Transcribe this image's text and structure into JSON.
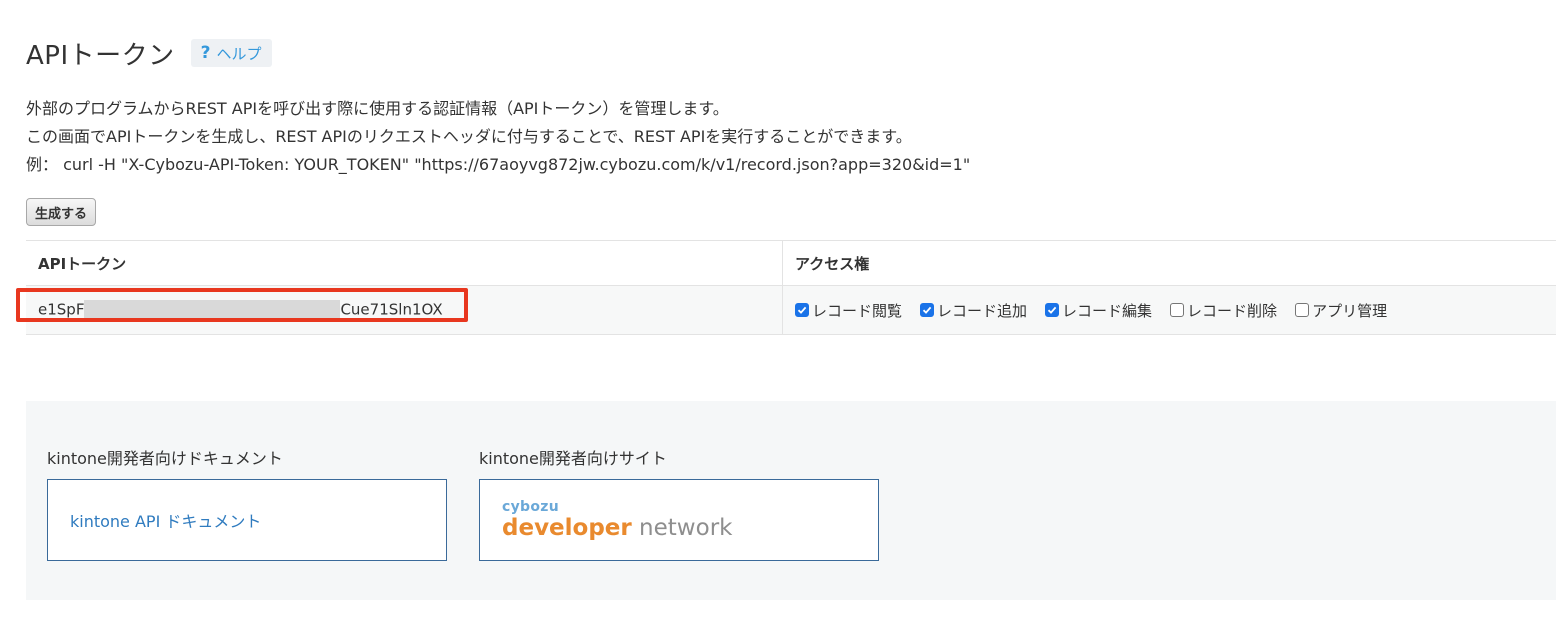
{
  "header": {
    "title": "APIトークン",
    "help_icon": "?",
    "help_label": "ヘルプ"
  },
  "description": {
    "line1": "外部のプログラムからREST APIを呼び出す際に使用する認証情報（APIトークン）を管理します。",
    "line2": "この画面でAPIトークンを生成し、REST APIのリクエストヘッダに付与することで、REST APIを実行することができます。",
    "line3": "例：  curl -H \"X-Cybozu-API-Token: YOUR_TOKEN\" \"https://67aoyvg872jw.cybozu.com/k/v1/record.json?app=320&id=1\""
  },
  "generate_button": "生成する",
  "table": {
    "col_token": "APIトークン",
    "col_access": "アクセス権",
    "row": {
      "token_prefix": "e1SpF",
      "token_suffix": "Cue71Sln1OX",
      "permissions": [
        {
          "label": "レコード閲覧",
          "checked": true
        },
        {
          "label": "レコード追加",
          "checked": true
        },
        {
          "label": "レコード編集",
          "checked": true
        },
        {
          "label": "レコード削除",
          "checked": false
        },
        {
          "label": "アプリ管理",
          "checked": false
        }
      ]
    }
  },
  "developer": {
    "docs_heading": "kintone開発者向けドキュメント",
    "docs_link": "kintone API ドキュメント",
    "site_heading": "kintone開発者向けサイト",
    "logo_top": "cybozu",
    "logo_dev": "developer",
    "logo_net": " network"
  },
  "colors": {
    "highlight": "#e8371f",
    "checkbox_on": "#1a73e8",
    "link": "#2f7bbf"
  }
}
